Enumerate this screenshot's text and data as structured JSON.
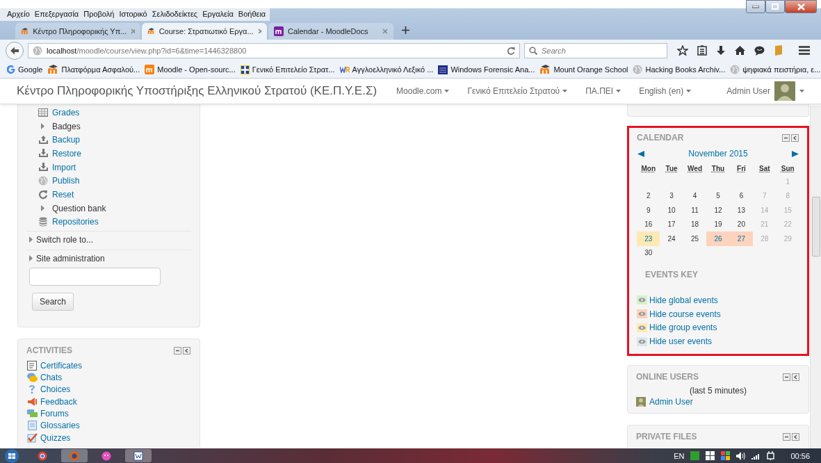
{
  "browser_menu": [
    "Αρχείο",
    "Επεξεργασία",
    "Προβολή",
    "Ιστορικό",
    "Σελιδοδείκτες",
    "Εργαλεία",
    "Βοήθεια"
  ],
  "tabs": [
    {
      "title": "Κέντρο Πληροφορικής Υπ...",
      "selected": false
    },
    {
      "title": "Course: Στρατιωτικό Εργα...",
      "selected": true
    },
    {
      "title": "Calendar - MoodleDocs",
      "selected": false
    }
  ],
  "address": {
    "host": "localhost",
    "path": "/moodle/course/view.php?id=6&time=1446328800"
  },
  "search": {
    "placeholder": "Search"
  },
  "bookmarks": [
    {
      "label": "Google"
    },
    {
      "label": "Πλατφόρμα Ασφαλού..."
    },
    {
      "label": "Moodle - Open-sourc..."
    },
    {
      "label": "Γενικό Επιτελείο Στρατ..."
    },
    {
      "label": "Αγγλοελληνικό Λεξικό ..."
    },
    {
      "label": "Windows Forensic Ana..."
    },
    {
      "label": "Mount Orange School"
    },
    {
      "label": "Hacking Books Archiv..."
    },
    {
      "label": "ψηφιακά πειστήρια, ε..."
    }
  ],
  "navbar": {
    "brand": "Κέντρο Πληροφορικής Υποστήριξης Ελληνικού Στρατού (ΚΕ.Π.Υ.Ε.Σ)",
    "menus": [
      "Moodle.com",
      "Γενικό Επιτελείο Στρατού",
      "ΠΑ.ΠΕΙ",
      "English (en)"
    ],
    "user": "Admin User"
  },
  "navigation": {
    "items": [
      {
        "label": "Grades",
        "kind": "link"
      },
      {
        "label": "Badges",
        "kind": "branch"
      },
      {
        "label": "Backup",
        "kind": "link"
      },
      {
        "label": "Restore",
        "kind": "link"
      },
      {
        "label": "Import",
        "kind": "link"
      },
      {
        "label": "Publish",
        "kind": "link"
      },
      {
        "label": "Reset",
        "kind": "link"
      },
      {
        "label": "Question bank",
        "kind": "branch"
      },
      {
        "label": "Repositories",
        "kind": "link"
      }
    ],
    "sections": [
      "Switch role to...",
      "Site administration"
    ],
    "search_button": "Search"
  },
  "activities": {
    "title": "ACTIVITIES",
    "items": [
      "Certificates",
      "Chats",
      "Choices",
      "Feedback",
      "Forums",
      "Glossaries",
      "Quizzes"
    ]
  },
  "calendar": {
    "title": "CALENDAR",
    "month": "November 2015",
    "weekdays": [
      "Mon",
      "Tue",
      "Wed",
      "Thu",
      "Fri",
      "Sat",
      "Sun"
    ],
    "weeks": [
      [
        {
          "kind": "blank"
        },
        {
          "kind": "blank"
        },
        {
          "kind": "blank"
        },
        {
          "kind": "blank"
        },
        {
          "kind": "blank"
        },
        {
          "kind": "blank"
        },
        {
          "kind": "day",
          "day": "1",
          "weekend": true
        }
      ],
      [
        {
          "kind": "day",
          "day": "2",
          "weekend": false
        },
        {
          "kind": "day",
          "day": "3",
          "weekend": false
        },
        {
          "kind": "day",
          "day": "4",
          "weekend": false
        },
        {
          "kind": "day",
          "day": "5",
          "weekend": false
        },
        {
          "kind": "day",
          "day": "6",
          "weekend": false
        },
        {
          "kind": "day",
          "day": "7",
          "weekend": true
        },
        {
          "kind": "day",
          "day": "8",
          "weekend": true
        }
      ],
      [
        {
          "kind": "day",
          "day": "9",
          "weekend": false
        },
        {
          "kind": "day",
          "day": "10",
          "weekend": false
        },
        {
          "kind": "day",
          "day": "11",
          "weekend": false
        },
        {
          "kind": "day",
          "day": "12",
          "weekend": false
        },
        {
          "kind": "day",
          "day": "13",
          "weekend": false
        },
        {
          "kind": "day",
          "day": "14",
          "weekend": true
        },
        {
          "kind": "day",
          "day": "15",
          "weekend": true
        }
      ],
      [
        {
          "kind": "day",
          "day": "16",
          "weekend": false
        },
        {
          "kind": "day",
          "day": "17",
          "weekend": false
        },
        {
          "kind": "day",
          "day": "18",
          "weekend": false
        },
        {
          "kind": "day",
          "day": "19",
          "weekend": false
        },
        {
          "kind": "day",
          "day": "20",
          "weekend": false
        },
        {
          "kind": "day",
          "day": "21",
          "weekend": true
        },
        {
          "kind": "day",
          "day": "22",
          "weekend": true
        }
      ],
      [
        {
          "kind": "day",
          "day": "23",
          "weekend": false,
          "color": "#fde9b4"
        },
        {
          "kind": "day",
          "day": "24",
          "weekend": false
        },
        {
          "kind": "day",
          "day": "25",
          "weekend": false
        },
        {
          "kind": "day",
          "day": "26",
          "weekend": false,
          "color": "#fdd3bd"
        },
        {
          "kind": "day",
          "day": "27",
          "weekend": false,
          "color": "#fdd3bd"
        },
        {
          "kind": "day",
          "day": "28",
          "weekend": true
        },
        {
          "kind": "day",
          "day": "29",
          "weekend": true
        }
      ],
      [
        {
          "kind": "day",
          "day": "30",
          "weekend": false
        }
      ]
    ],
    "key_title": "EVENTS KEY",
    "key": [
      {
        "label": "Hide global events",
        "color": "#d6f2cc"
      },
      {
        "label": "Hide course events",
        "color": "#fdd3bd"
      },
      {
        "label": "Hide group events",
        "color": "#fde9b4"
      },
      {
        "label": "Hide user events",
        "color": "#dce7ec"
      }
    ]
  },
  "online_users": {
    "title": "ONLINE USERS",
    "note": "(last 5 minutes)",
    "user": "Admin User"
  },
  "private_files": {
    "title": "PRIVATE FILES"
  },
  "taskbar": {
    "language": "EN",
    "time": "00:56"
  }
}
